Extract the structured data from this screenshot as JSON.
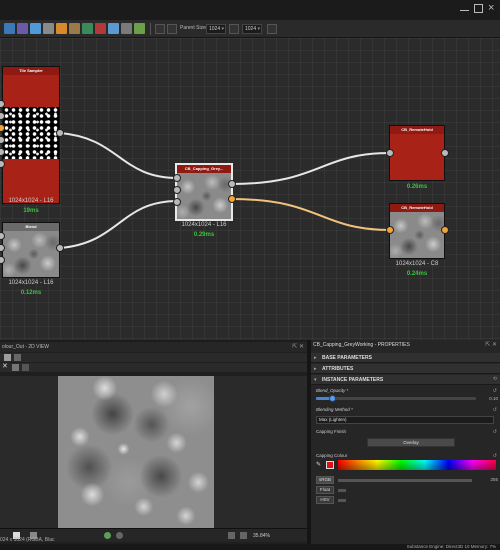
{
  "toolbar": {
    "parent_size_label": "Parent Size",
    "size_value_1": "1024",
    "size_value_2": "1024",
    "buttons": [
      "graph-icon",
      "frame-icon",
      "comment-icon",
      "pin-icon",
      "filter-icon",
      "link-icon",
      "script-icon",
      "lock-icon",
      "chart-icon",
      "gear-icon",
      "camera-icon"
    ]
  },
  "graph": {
    "nodes": {
      "tile_sampler": {
        "title": "Tile Sampler",
        "info": "1024x1024 - L16",
        "time": "19ms"
      },
      "blend": {
        "title": "Blend",
        "info": "1024x1024 - L16",
        "time": "0.12ms"
      },
      "capping": {
        "title": "CB_Capping_Grey...",
        "info": "1024x1024 - L16",
        "time": "0.29ms"
      },
      "remote_top": {
        "title": "CB_RemoteHold",
        "time": "0.26ms"
      },
      "remote_bottom": {
        "title": "CB_RemoteHold",
        "info": "1024x1024 - C8",
        "time": "0.24ms"
      }
    },
    "colors": {
      "wire": "#e6e6e6",
      "wire_active": "#f1c27d",
      "node_red": "#a82218",
      "time_green": "#35c73b"
    }
  },
  "view2d": {
    "title": "olour_Out - 2D VIEW",
    "resolution": "024 x 1024 (RGBA, Blac",
    "zoom": "35.84%"
  },
  "properties": {
    "title": "CB_Capping_GreyWorking - PROPERTIES",
    "sections": {
      "base": "BASE PARAMETERS",
      "attributes": "ATTRIBUTES",
      "instance": "INSTANCE PARAMETERS"
    },
    "blend_opacity": {
      "label": "Blend_Opacity *",
      "value_text": "0.10",
      "value": 0.1
    },
    "blending_method": {
      "label": "Blending Method *",
      "value": "Max (Lighten)"
    },
    "capping_finish": {
      "label": "Capping Finish",
      "value": "Overlay"
    },
    "capping_colour": {
      "label": "Capping Colour",
      "swatch": "#e01010"
    },
    "modes": [
      "sRGB",
      "Float",
      "HSV"
    ],
    "channel_value": "255"
  },
  "status": {
    "text": "Substance Engine: Direct3D 10   Memory: 7%"
  }
}
